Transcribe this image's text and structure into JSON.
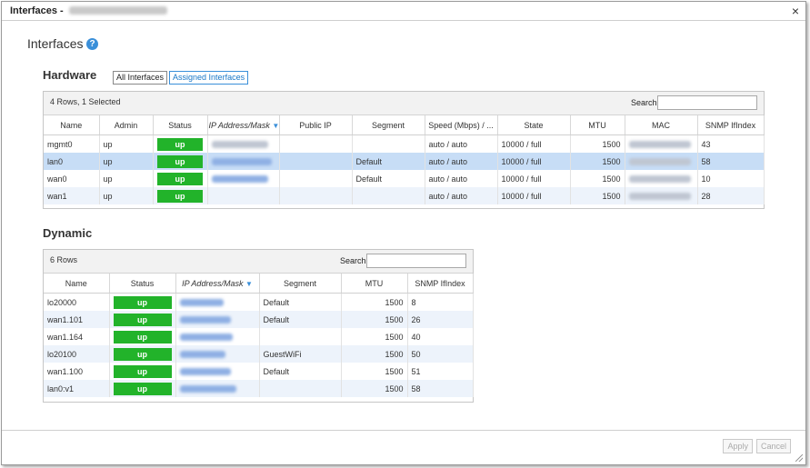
{
  "window": {
    "title": "Interfaces - ",
    "close_symbol": "×"
  },
  "page": {
    "heading": "Interfaces",
    "help_symbol": "?"
  },
  "hardware": {
    "title": "Hardware",
    "tabs": [
      "All Interfaces",
      "Assigned Interfaces"
    ],
    "active_tab": "Assigned Interfaces",
    "row_count": "4 Rows, 1 Selected",
    "search_label": "Search",
    "columns": [
      "Name",
      "Admin",
      "Status",
      "IP Address/Mask",
      "Public IP",
      "Segment",
      "Speed (Mbps) / ...",
      "State",
      "MTU",
      "MAC",
      "SNMP IfIndex"
    ],
    "sort_arrow": "▼",
    "rows": [
      {
        "name": "mgmt0",
        "admin": "up",
        "status": "up",
        "segment": "",
        "speed": "auto / auto",
        "state": "10000 / full",
        "mtu": "1500",
        "snmp": "43"
      },
      {
        "name": "lan0",
        "admin": "up",
        "status": "up",
        "segment": "Default",
        "speed": "auto / auto",
        "state": "10000 / full",
        "mtu": "1500",
        "snmp": "58"
      },
      {
        "name": "wan0",
        "admin": "up",
        "status": "up",
        "segment": "Default",
        "speed": "auto / auto",
        "state": "10000 / full",
        "mtu": "1500",
        "snmp": "10"
      },
      {
        "name": "wan1",
        "admin": "up",
        "status": "up",
        "segment": "",
        "speed": "auto / auto",
        "state": "10000 / full",
        "mtu": "1500",
        "snmp": "28"
      }
    ]
  },
  "dynamic": {
    "title": "Dynamic",
    "row_count": "6 Rows",
    "search_label": "Search",
    "columns": [
      "Name",
      "Status",
      "IP Address/Mask",
      "Segment",
      "MTU",
      "SNMP IfIndex"
    ],
    "sort_arrow": "▼",
    "rows": [
      {
        "name": "lo20000",
        "status": "up",
        "segment": "Default",
        "mtu": "1500",
        "snmp": "8"
      },
      {
        "name": "wan1.101",
        "status": "up",
        "segment": "Default",
        "mtu": "1500",
        "snmp": "26"
      },
      {
        "name": "wan1.164",
        "status": "up",
        "segment": "",
        "mtu": "1500",
        "snmp": "40"
      },
      {
        "name": "lo20100",
        "status": "up",
        "segment": "GuestWiFi",
        "mtu": "1500",
        "snmp": "50"
      },
      {
        "name": "wan1.100",
        "status": "up",
        "segment": "Default",
        "mtu": "1500",
        "snmp": "51"
      },
      {
        "name": "lan0:v1",
        "status": "up",
        "segment": "",
        "mtu": "1500",
        "snmp": "58"
      }
    ]
  },
  "footer": {
    "apply_label": "Apply",
    "cancel_label": "Cancel"
  },
  "colors": {
    "status_up": "#22b32a",
    "accent": "#3a8fd9",
    "selected_row": "#c7ddf6",
    "alt_row": "#edf3fb"
  }
}
